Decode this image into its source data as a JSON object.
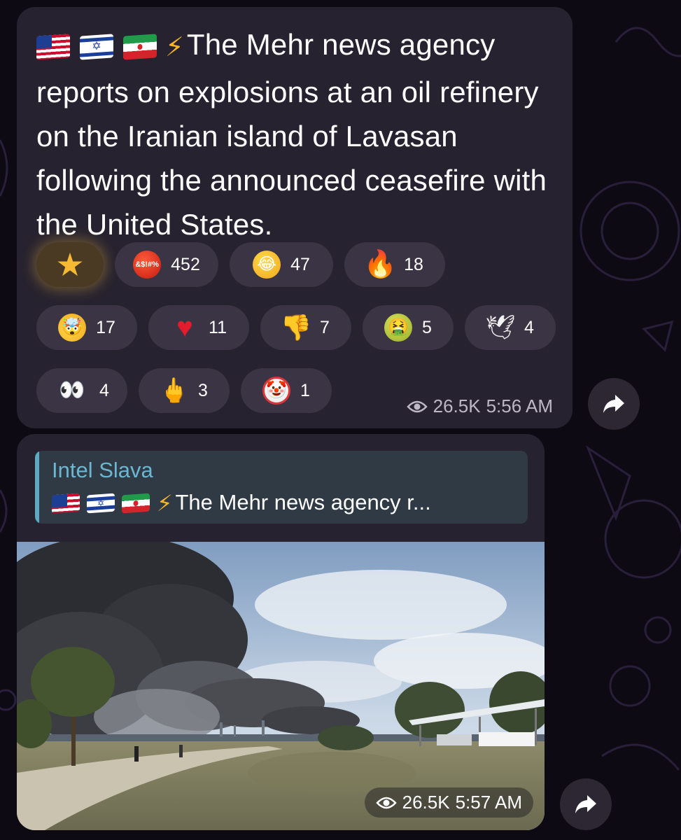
{
  "messages": [
    {
      "text": "The Mehr news agency reports on explosions at an oil refinery on the Iranian island of Lavasan following the announced ceasefire with the United States.",
      "flag_icons": [
        "us-flag-icon",
        "israel-flag-icon",
        "iran-flag-icon"
      ],
      "lead_icon": "lightning-icon",
      "reactions": [
        {
          "icon": "star-icon",
          "count": ""
        },
        {
          "icon": "swearing-face-icon",
          "count": "452"
        },
        {
          "icon": "rofl-face-icon",
          "count": "47"
        },
        {
          "icon": "fire-icon",
          "count": "18"
        },
        {
          "icon": "mind-blown-icon",
          "count": "17"
        },
        {
          "icon": "heart-icon",
          "count": "11"
        },
        {
          "icon": "thumbs-down-icon",
          "count": "7"
        },
        {
          "icon": "vomit-face-icon",
          "count": "5"
        },
        {
          "icon": "dove-icon",
          "count": "4"
        },
        {
          "icon": "eyes-icon",
          "count": "4"
        },
        {
          "icon": "middle-finger-icon",
          "count": "3"
        },
        {
          "icon": "clown-icon",
          "count": "1"
        }
      ],
      "views": "26.5K",
      "time": "5:56 AM"
    },
    {
      "reply_author": "Intel Slava",
      "reply_snippet": "The Mehr news agency r...",
      "views": "26.5K",
      "time": "5:57 AM"
    }
  ],
  "colors": {
    "background": "#0e0a14",
    "bubble": "#27222f",
    "reaction_pill": "#3a3444",
    "reply_accent": "#5fa8c4",
    "meta_text": "#bdb6c6"
  }
}
